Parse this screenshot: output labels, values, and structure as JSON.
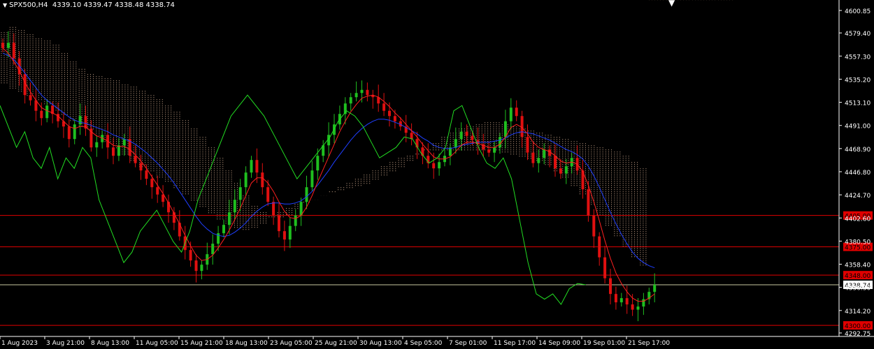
{
  "header": {
    "symbol": "SPX500,H4",
    "ohlc": "4339.10 4339.47 4338.48 4338.74"
  },
  "colors": {
    "background": "#000000",
    "bull": "#1fbf1f",
    "bear": "#e01010",
    "kijun": "#1f3fff",
    "tenkan": "#ff2020",
    "chikou": "#22dd22",
    "cloud": "#f4c8a8",
    "level": "#e00000",
    "price_line": "#c8c8a0"
  },
  "chart_data": {
    "type": "candlestick",
    "symbol": "SPX500",
    "timeframe": "H4",
    "y_axis": {
      "range": [
        4292.75,
        4600.85
      ],
      "tick_labels": [
        "4600.85",
        "4579.40",
        "4557.30",
        "4535.20",
        "4513.10",
        "4491.00",
        "4468.90",
        "4446.80",
        "4424.70",
        "4402.60",
        "4380.50",
        "4358.40",
        "4336.30",
        "4314.20",
        "4292.75"
      ]
    },
    "x_axis": {
      "tick_labels": [
        "1 Aug 2023",
        "3 Aug 21:00",
        "8 Aug 13:00",
        "11 Aug 05:00",
        "15 Aug 21:00",
        "18 Aug 13:00",
        "23 Aug 05:00",
        "25 Aug 21:00",
        "30 Aug 13:00",
        "4 Sep 05:00",
        "7 Sep 01:00",
        "11 Sep 17:00",
        "14 Sep 09:00",
        "19 Sep 01:00",
        "21 Sep 17:00"
      ]
    },
    "current_price": {
      "value": 4338.74,
      "label": "4338.74"
    },
    "levels": [
      {
        "value": 4405.0,
        "label": "4405.00"
      },
      {
        "value": 4375.0,
        "label": "4375.00"
      },
      {
        "value": 4348.0,
        "label": "4348.00"
      },
      {
        "value": 4300.0,
        "label": "4300.00"
      }
    ],
    "candles_close": [
      4565,
      4570,
      4555,
      4540,
      4520,
      4515,
      4505,
      4498,
      4510,
      4502,
      4495,
      4490,
      4478,
      4492,
      4500,
      4488,
      4470,
      4475,
      4482,
      4470,
      4462,
      4472,
      4478,
      4462,
      4455,
      4448,
      4440,
      4432,
      4425,
      4418,
      4408,
      4398,
      4385,
      4372,
      4362,
      4352,
      4358,
      4368,
      4378,
      4388,
      4396,
      4408,
      4420,
      4432,
      4446,
      4458,
      4446,
      4432,
      4418,
      4405,
      4390,
      4382,
      4395,
      4405,
      4418,
      4432,
      4448,
      4462,
      4472,
      4482,
      4492,
      4502,
      4512,
      4518,
      4522,
      4525,
      4520,
      4518,
      4512,
      4505,
      4500,
      4495,
      4490,
      4484,
      4478,
      4470,
      4462,
      4455,
      4450,
      4456,
      4462,
      4470,
      4478,
      4485,
      4481,
      4477,
      4473,
      4468,
      4465,
      4470,
      4480,
      4495,
      4508,
      4500,
      4480,
      4465,
      4455,
      4460,
      4468,
      4462,
      4450,
      4445,
      4452,
      4460,
      4448,
      4430,
      4405,
      4385,
      4365,
      4345,
      4330,
      4322,
      4326,
      4320,
      4315,
      4318,
      4325,
      4332,
      4338.74
    ],
    "tenkan": [
      4565,
      4560,
      4552,
      4543,
      4532,
      4523,
      4515,
      4508,
      4505,
      4503,
      4500,
      4495,
      4490,
      4488,
      4490,
      4490,
      4485,
      4481,
      4479,
      4476,
      4472,
      4471,
      4471,
      4468,
      4463,
      4457,
      4450,
      4442,
      4434,
      4426,
      4417,
      4407,
      4397,
      4386,
      4376,
      4367,
      4362,
      4363,
      4367,
      4374,
      4382,
      4391,
      4401,
      4412,
      4424,
      4436,
      4441,
      4441,
      4436,
      4428,
      4418,
      4409,
      4403,
      4402,
      4405,
      4413,
      4424,
      4437,
      4449,
      4461,
      4473,
      4485,
      4495,
      4504,
      4511,
      4517,
      4519,
      4520,
      4518,
      4514,
      4509,
      4503,
      4498,
      4492,
      4486,
      4480,
      4473,
      4467,
      4461,
      4459,
      4459,
      4461,
      4466,
      4472,
      4475,
      4475,
      4474,
      4472,
      4470,
      4470,
      4473,
      4480,
      4489,
      4492,
      4489,
      4483,
      4475,
      4470,
      4468,
      4466,
      4462,
      4457,
      4455,
      4456,
      4454,
      4447,
      4434,
      4418,
      4400,
      4381,
      4364,
      4350,
      4340,
      4332,
      4326,
      4323,
      4323,
      4326,
      4330
    ],
    "kijun": [
      4560,
      4558,
      4554,
      4548,
      4541,
      4534,
      4527,
      4520,
      4515,
      4511,
      4507,
      4503,
      4499,
      4496,
      4494,
      4493,
      4491,
      4489,
      4487,
      4485,
      4482,
      4480,
      4478,
      4476,
      4473,
      4469,
      4465,
      4460,
      4455,
      4449,
      4443,
      4436,
      4428,
      4420,
      4412,
      4404,
      4397,
      4392,
      4388,
      4386,
      4385,
      4386,
      4389,
      4393,
      4398,
      4404,
      4409,
      4413,
      4416,
      4417,
      4417,
      4416,
      4416,
      4417,
      4419,
      4423,
      4428,
      4434,
      4441,
      4448,
      4456,
      4463,
      4470,
      4477,
      4483,
      4488,
      4492,
      4495,
      4497,
      4497,
      4496,
      4494,
      4492,
      4489,
      4486,
      4483,
      4479,
      4476,
      4472,
      4470,
      4469,
      4469,
      4470,
      4472,
      4473,
      4474,
      4475,
      4475,
      4475,
      4476,
      4477,
      4479,
      4482,
      4484,
      4485,
      4484,
      4483,
      4481,
      4479,
      4477,
      4474,
      4471,
      4468,
      4466,
      4463,
      4459,
      4452,
      4443,
      4432,
      4420,
      4408,
      4397,
      4387,
      4378,
      4370,
      4364,
      4360,
      4357,
      4355
    ],
    "chikou": [
      4510,
      4490,
      4470,
      4485,
      4460,
      4450,
      4470,
      4440,
      4460,
      4450,
      4470,
      4460,
      4420,
      4400,
      4380,
      4360,
      4370,
      4390,
      4400,
      4410,
      4395,
      4380,
      4370,
      4390,
      4420,
      4440,
      4460,
      4480,
      4500,
      4510,
      4520,
      4510,
      4500,
      4485,
      4470,
      4455,
      4440,
      4450,
      4460,
      4470,
      4480,
      4495,
      4505,
      4500,
      4490,
      4475,
      4460,
      4465,
      4470,
      4480,
      4478,
      4465,
      4455,
      4460,
      4470,
      4505,
      4510,
      4490,
      4470,
      4455,
      4450,
      4460,
      4440,
      4400,
      4360,
      4330,
      4325,
      4330,
      4320,
      4335,
      4340,
      4338.74
    ],
    "cloud_top": [
      4580,
      4585,
      4582,
      4578,
      4574,
      4572,
      4568,
      4560,
      4552,
      4545,
      4540,
      4538,
      4536,
      4534,
      4530,
      4528,
      4524,
      4520,
      4516,
      4510,
      4504,
      4496,
      4488,
      4480,
      4470,
      4460,
      4448,
      4436,
      4424,
      4414,
      4408,
      4404,
      4402,
      4405,
      4410,
      4416,
      4420,
      4424,
      4426,
      4428,
      4430,
      4432,
      4434,
      4438,
      4442,
      4446,
      4450,
      4456,
      4462,
      4468,
      4474,
      4480,
      4484,
      4488,
      4490,
      4492,
      4494,
      4494,
      4492,
      4490,
      4488,
      4486,
      4484,
      4482,
      4480,
      4478,
      4476,
      4474,
      4472,
      4470,
      4468,
      4466,
      4462,
      4456,
      4450,
      4442,
      4434,
      4426,
      4416,
      4406,
      4396,
      4386,
      4376,
      4366,
      4358
    ],
    "cloud_bottom": [
      4530,
      4526,
      4522,
      4518,
      4514,
      4510,
      4505,
      4500,
      4495,
      4490,
      4486,
      4480,
      4474,
      4468,
      4462,
      4456,
      4450,
      4446,
      4440,
      4436,
      4430,
      4424,
      4418,
      4412,
      4406,
      4400,
      4396,
      4392,
      4390,
      4392,
      4396,
      4402,
      4408,
      4412,
      4416,
      4418,
      4420,
      4424,
      4428,
      4432,
      4436,
      4440,
      4444,
      4448,
      4452,
      4456,
      4460,
      4462,
      4464,
      4466,
      4466,
      4466,
      4466,
      4466,
      4466,
      4466,
      4466,
      4466,
      4464,
      4462,
      4460,
      4458,
      4456,
      4452,
      4446,
      4440,
      4432,
      4424,
      4414,
      4404,
      4394,
      4384,
      4374,
      4364,
      4356
    ]
  }
}
